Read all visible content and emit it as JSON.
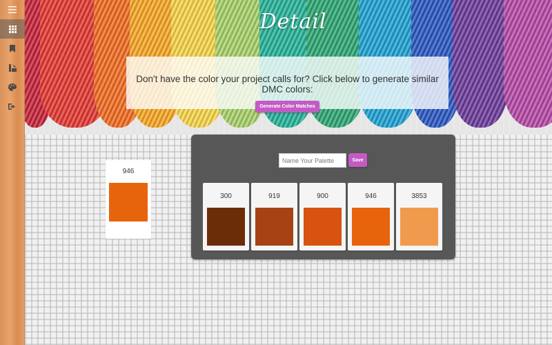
{
  "page": {
    "title": "Detail"
  },
  "sidebar": {
    "items": [
      {
        "name": "menu",
        "icon": "hamburger-icon"
      },
      {
        "name": "grid",
        "icon": "grid-icon"
      },
      {
        "name": "bookmark",
        "icon": "bookmark-icon"
      },
      {
        "name": "tools",
        "icon": "brush-ruler-icon"
      },
      {
        "name": "palette",
        "icon": "palette-icon"
      },
      {
        "name": "logout",
        "icon": "logout-icon"
      }
    ]
  },
  "banner": {
    "message": "Don't have the color your project calls for? Click below to generate similar DMC colors:",
    "button_label": "Generate Color Matches"
  },
  "selected": {
    "code": "946",
    "color": "#e8640c"
  },
  "palette": {
    "name_placeholder": "Name Your Palette",
    "save_label": "Save",
    "swatches": [
      {
        "code": "300",
        "color": "#6b2c08"
      },
      {
        "code": "919",
        "color": "#a64214"
      },
      {
        "code": "900",
        "color": "#d85210"
      },
      {
        "code": "946",
        "color": "#e8640c"
      },
      {
        "code": "3853",
        "color": "#f09a4e"
      }
    ]
  },
  "colors": {
    "accent": "#c35bc4",
    "panel": "#575757"
  }
}
